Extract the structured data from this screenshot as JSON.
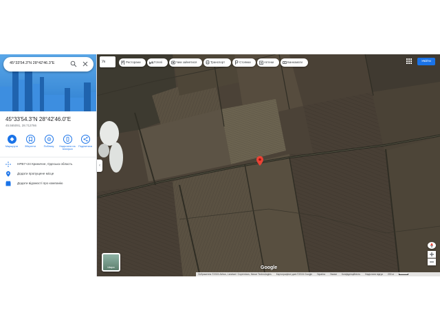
{
  "search": {
    "query": "45°33'54.3\"N 28°42'46.3\"E"
  },
  "place": {
    "title": "45°33'54.3\"N 28°42'46.0\"E",
    "decimal": "45.565091, 28.712766"
  },
  "actions": [
    {
      "label": "Маршрути",
      "icon": "directions-icon"
    },
    {
      "label": "Зберегти",
      "icon": "bookmark-icon"
    },
    {
      "label": "Поблизу",
      "icon": "nearby-icon"
    },
    {
      "label": "Надіслати на телефон",
      "icon": "phone-icon"
    },
    {
      "label": "Поділитися",
      "icon": "share-icon"
    }
  ],
  "info": [
    {
      "text": "HPB7+24 Криничне, Одеська область",
      "icon": "plus-code-icon"
    },
    {
      "text": "Додати пропущене місце",
      "icon": "add-place-icon"
    },
    {
      "text": "Додати відомості про компанію",
      "icon": "add-business-icon"
    }
  ],
  "map": {
    "context_chip": "Ук",
    "chips": [
      {
        "label": "Ресторани",
        "icon": "restaurant-icon"
      },
      {
        "label": "Готелі",
        "icon": "hotel-icon"
      },
      {
        "label": "Чим зайнятися",
        "icon": "attractions-icon"
      },
      {
        "label": "Транспорт",
        "icon": "transit-icon"
      },
      {
        "label": "Стоянки",
        "icon": "parking-icon"
      },
      {
        "label": "Аптеки",
        "icon": "pharmacy-icon"
      },
      {
        "label": "Банкомати",
        "icon": "atm-icon"
      }
    ],
    "signin_label": "Увійти",
    "google_mark": "Google",
    "layers_label": "Шари",
    "footer": [
      "Зображення ©2024 Airbus, Landsat / Copernicus, Maxar Technologies",
      "Картографічні дані ©2024 Google",
      "Україна",
      "Умови",
      "Конфіденційність",
      "Надіслати відгук",
      "200 м"
    ]
  },
  "colors": {
    "accent": "#1a73e8",
    "pin": "#ea4335"
  }
}
